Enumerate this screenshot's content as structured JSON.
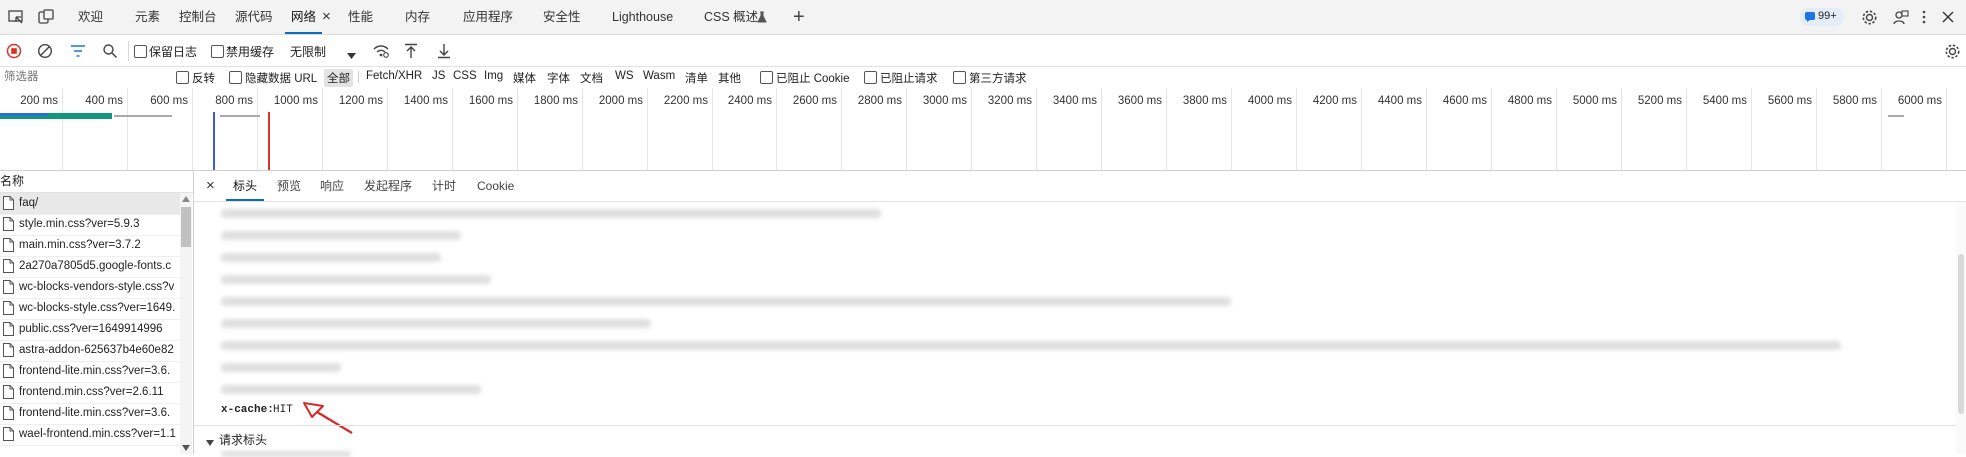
{
  "tabbar": {
    "tabs": [
      "欢迎",
      "元素",
      "控制台",
      "源代码",
      "网络",
      "性能",
      "内存",
      "应用程序",
      "安全性",
      "Lighthouse",
      "CSS 概述"
    ],
    "active_index": 4,
    "issues_badge": "99+",
    "add_tab_label": "+",
    "close_glyph": "×"
  },
  "toolbar": {
    "preserve_log": "保留日志",
    "disable_cache": "禁用缓存",
    "throttle": "无限制"
  },
  "filterbar": {
    "placeholder": "筛选器",
    "invert": "反转",
    "hide_data_urls": "隐藏数据 URL",
    "types": [
      "全部",
      "Fetch/XHR",
      "JS",
      "CSS",
      "Img",
      "媒体",
      "字体",
      "文档",
      "WS",
      "Wasm",
      "清单",
      "其他"
    ],
    "active_type_index": 0,
    "blocked_cookies": "已阻止 Cookie",
    "blocked_requests": "已阻止请求",
    "third_party": "第三方请求"
  },
  "timeline": {
    "ticks": [
      "200 ms",
      "400 ms",
      "600 ms",
      "800 ms",
      "1000 ms",
      "1200 ms",
      "1400 ms",
      "1600 ms",
      "1800 ms",
      "2000 ms",
      "2200 ms",
      "2400 ms",
      "2600 ms",
      "2800 ms",
      "3000 ms",
      "3200 ms",
      "3400 ms",
      "3600 ms",
      "3800 ms",
      "4000 ms",
      "4200 ms",
      "4400 ms",
      "4600 ms",
      "4800 ms",
      "5000 ms",
      "5200 ms",
      "5400 ms",
      "5600 ms",
      "5800 ms",
      "6000 ms"
    ]
  },
  "requests": {
    "header": "名称",
    "items": [
      "faq/",
      "style.min.css?ver=5.9.3",
      "main.min.css?ver=3.7.2",
      "2a270a7805d5.google-fonts.c",
      "wc-blocks-vendors-style.css?v",
      "wc-blocks-style.css?ver=1649.",
      "public.css?ver=1649914996",
      "astra-addon-625637b4e60e82",
      "frontend-lite.min.css?ver=3.6.",
      "frontend.min.css?ver=2.6.11",
      "frontend-lite.min.css?ver=3.6.",
      "wael-frontend.min.css?ver=1.1"
    ]
  },
  "detail": {
    "close_glyph": "×",
    "tabs": [
      "标头",
      "预览",
      "响应",
      "发起程序",
      "计时",
      "Cookie"
    ],
    "active_index": 0,
    "header_key": "x-cache:",
    "header_value": "HIT",
    "request_headers_section": "请求标头"
  }
}
